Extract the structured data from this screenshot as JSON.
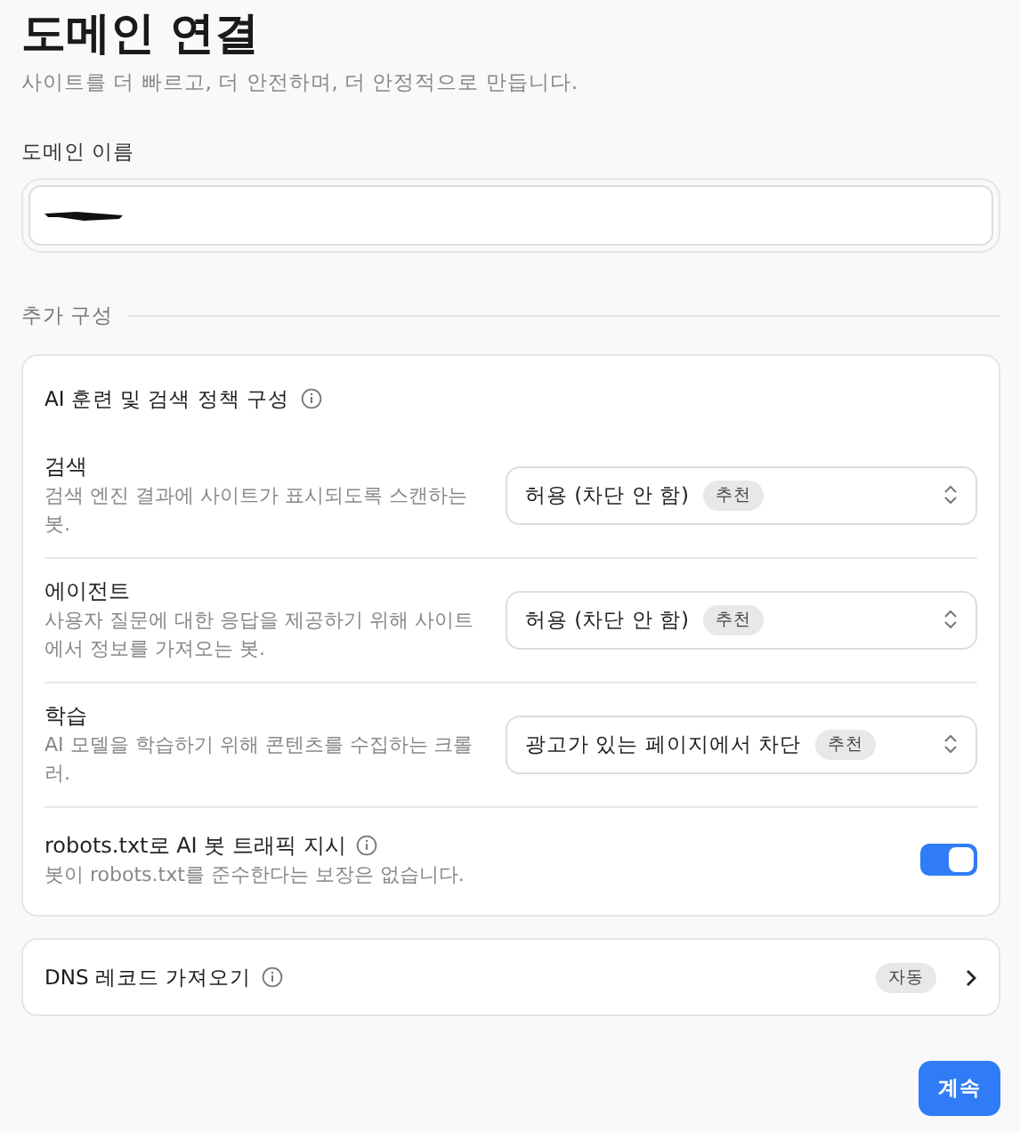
{
  "title": "도메인 연결",
  "subtitle": "사이트를 더 빠르고, 더 안전하며, 더 안정적으로 만듭니다.",
  "domain_field": {
    "label": "도메인 이름",
    "redacted": true
  },
  "section_label": "추가 구성",
  "policy_card": {
    "title": "AI 훈련 및 검색 정책 구성",
    "rows": [
      {
        "kind": "select",
        "title": "검색",
        "description": "검색 엔진 결과에 사이트가 표시되도록 스캔하는 봇.",
        "value": "허용 (차단 안 함)",
        "badge": "추천"
      },
      {
        "kind": "select",
        "title": "에이전트",
        "description": "사용자 질문에 대한 응답을 제공하기 위해 사이트에서 정보를 가져오는 봇.",
        "value": "허용 (차단 안 함)",
        "badge": "추천"
      },
      {
        "kind": "select",
        "title": "학습",
        "description": "AI 모델을 학습하기 위해 콘텐츠를 수집하는 크롤러.",
        "value": "광고가 있는 페이지에서 차단",
        "badge": "추천"
      },
      {
        "kind": "toggle",
        "title": "robots.txt로 AI 봇 트래픽 지시",
        "description": "봇이 robots.txt를 준수한다는 보장은 없습니다.",
        "on": true
      }
    ]
  },
  "dns_card": {
    "title": "DNS 레코드 가져오기",
    "badge": "자동"
  },
  "continue_button": "계속"
}
